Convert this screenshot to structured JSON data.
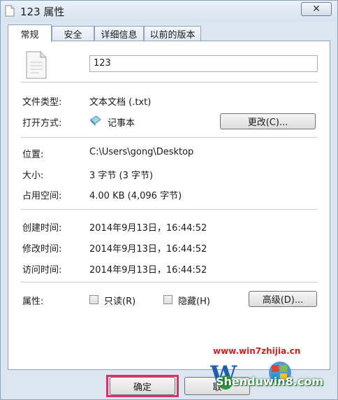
{
  "window": {
    "title": "123 属性",
    "close_label": "✕"
  },
  "tabs": [
    {
      "label": "常规",
      "active": true
    },
    {
      "label": "安全",
      "active": false
    },
    {
      "label": "详细信息",
      "active": false
    },
    {
      "label": "以前的版本",
      "active": false
    }
  ],
  "general": {
    "file_name": "123",
    "file_type_label": "文件类型:",
    "file_type_value": "文本文档 (.txt)",
    "opens_with_label": "打开方式:",
    "opens_with_value": "记事本",
    "change_button": "更改(C)...",
    "location_label": "位置:",
    "location_value": "C:\\Users\\gong\\Desktop",
    "size_label": "大小:",
    "size_value": "3 字节 (3 字节)",
    "size_on_disk_label": "占用空间:",
    "size_on_disk_value": "4.00 KB (4,096 字节)",
    "created_label": "创建时间:",
    "created_value": "2014年9月13日，16:44:52",
    "modified_label": "修改时间:",
    "modified_value": "2014年9月13日，16:44:52",
    "accessed_label": "访问时间:",
    "accessed_value": "2014年9月13日，16:44:52",
    "attributes_label": "属性:",
    "readonly_label": "只读(R)",
    "hidden_label": "隐藏(H)",
    "advanced_button": "高级(D)..."
  },
  "footer": {
    "ok_button": "确定",
    "cancel_button": "取"
  },
  "watermark": {
    "url": "www.win7zhijia.cn",
    "brand": "Shenduwin8.com",
    "accent_red": "#d21f1f",
    "accent_green": "#2a9a3c"
  }
}
